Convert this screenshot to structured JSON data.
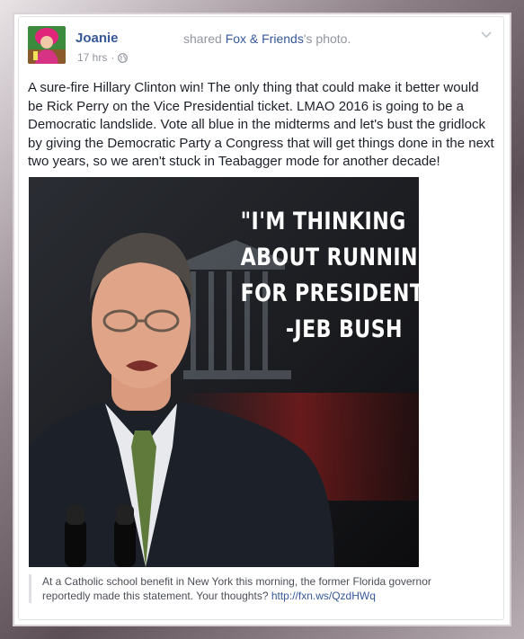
{
  "post": {
    "author": "Joanie",
    "shared_prefix": "shared",
    "shared_source": "Fox & Friends",
    "shared_suffix": "'s photo.",
    "time": "17 hrs",
    "separator": "·",
    "privacy_icon": "globe-icon",
    "options_icon": "chevron-down-icon",
    "text": "A sure-fire Hillary Clinton win! The only thing that could make it better would be Rick Perry on the Vice Presidential ticket. LMAO 2016 is going to be a Democratic landslide. Vote all blue in the midterms and let's bust the gridlock by giving the Democratic Party a Congress that will get things done in the next two years, so we aren't stuck in Teabagger mode for another decade!"
  },
  "photo": {
    "quote_lines": [
      "\"I'M THINKING",
      "ABOUT RUNNING",
      "FOR PRESIDENT.\"",
      "-JEB BUSH"
    ]
  },
  "caption": {
    "text": "At a Catholic school benefit in New York this morning, the former Florida governor reportedly made this statement. Your thoughts?",
    "link": "http://fxn.ws/QzdHWq"
  },
  "colors": {
    "link_blue": "#365899",
    "meta_gray": "#90949c",
    "text": "#1d2129"
  }
}
